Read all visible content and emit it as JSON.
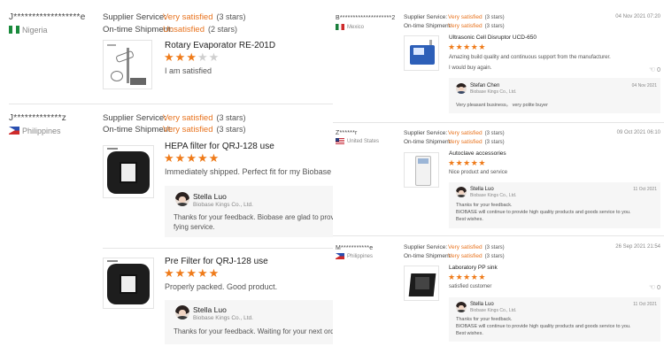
{
  "colors": {
    "accent": "#e8731e",
    "star": "#ef7b1a",
    "star_empty": "#cfcfcf"
  },
  "left": {
    "reviews": [
      {
        "name": "J******************e",
        "country": "Nigeria",
        "country_flag": "nigeria-flag-icon",
        "supplier_label": "Supplier Service:",
        "supplier_value": "Very satisfied",
        "supplier_count": "(3 stars)",
        "shipment_label": "On-time Shipment:",
        "shipment_value": "Unsatisfied",
        "shipment_count": "(2 stars)",
        "product": "Rotary Evaporator RE-201D",
        "rating": 3,
        "rating_max": 5,
        "text": "I am satisfied"
      },
      {
        "name": "J*************z",
        "country": "Philippines",
        "country_flag": "philippines-flag-icon",
        "supplier_label": "Supplier Service:",
        "supplier_value": "Very satisfied",
        "supplier_count": "(3 stars)",
        "shipment_label": "On-time Shipment:",
        "shipment_value": "Very satisfied",
        "shipment_count": "(3 stars)",
        "product": "HEPA filter for QRJ-128 use",
        "rating": 5,
        "rating_max": 5,
        "text": "Immediately shipped. Perfect fit for my Biobase Filter.",
        "reply": {
          "name": "Stella Luo",
          "company": "Biobase Kings Co., Ltd.",
          "line1": "Thanks for your feedback. Biobase are glad to provide",
          "line2": "fying service."
        }
      },
      {
        "product": "Pre Filter for QRJ-128 use",
        "rating": 5,
        "rating_max": 5,
        "text": "Properly packed. Good product.",
        "reply": {
          "name": "Stella Luo",
          "company": "Biobase Kings Co., Ltd.",
          "line1": "Thanks for your feedback. Waiting for your next order~"
        }
      }
    ]
  },
  "right": {
    "reviews": [
      {
        "name": "B********************2",
        "country": "Mexico",
        "country_flag": "mexico-flag-icon",
        "date": "04 Nov 2021 07:20",
        "supplier_label": "Supplier Service:",
        "supplier_value": "Very satisfied",
        "supplier_count": "(3 stars)",
        "shipment_label": "On-time Shipment:",
        "shipment_value": "Very satisfied",
        "shipment_count": "(3 stars)",
        "product": "Ultrasonic Cell Disruptor UCD-650",
        "rating": 5,
        "rating_max": 5,
        "text": "Amazing build quality and continuous support from the manufacturer.",
        "text2": "I would buy again.",
        "likes": "0",
        "reply": {
          "name": "Stefan Chen",
          "company": "Biobase Kings Co., Ltd.",
          "date": "04 Nov 2021",
          "line1": "Very pleasant business。 very polite buyer"
        }
      },
      {
        "name": "Z******r",
        "country": "United States",
        "country_flag": "usa-flag-icon",
        "date": "09 Oct 2021 06:10",
        "supplier_label": "Supplier Service:",
        "supplier_value": "Very satisfied",
        "supplier_count": "(3 stars)",
        "shipment_label": "On-time Shipment:",
        "shipment_value": "Very satisfied",
        "shipment_count": "(3 stars)",
        "product": "Autoclave accessories",
        "rating": 5,
        "rating_max": 5,
        "text": "Nice product and service",
        "likes": "0",
        "reply": {
          "name": "Stella Luo",
          "company": "Biobase Kings Co., Ltd.",
          "date": "11 Oct 2021",
          "line1": "Thanks for your feedback.",
          "line2": "BIOBASE will continue to provide high quality products and goods service to you.",
          "line3": "Best wishes."
        }
      },
      {
        "name": "M***********e",
        "country": "Philippines",
        "country_flag": "philippines-flag-icon",
        "date": "26 Sep 2021 21:54",
        "supplier_label": "Supplier Service:",
        "supplier_value": "Very satisfied",
        "supplier_count": "(3 stars)",
        "shipment_label": "On-time Shipment:",
        "shipment_value": "Very satisfied",
        "shipment_count": "(3 stars)",
        "product": "Laboratory PP sink",
        "rating": 5,
        "rating_max": 5,
        "text": "satisfied customer",
        "likes": "0",
        "reply": {
          "name": "Stella Luo",
          "company": "Biobase Kings Co., Ltd.",
          "date": "11 Oct 2021",
          "line1": "Thanks for your feedback.",
          "line2": "BIOBASE will continue to provide high quality products and goods service to you.",
          "line3": "Best wishes."
        }
      }
    ]
  }
}
